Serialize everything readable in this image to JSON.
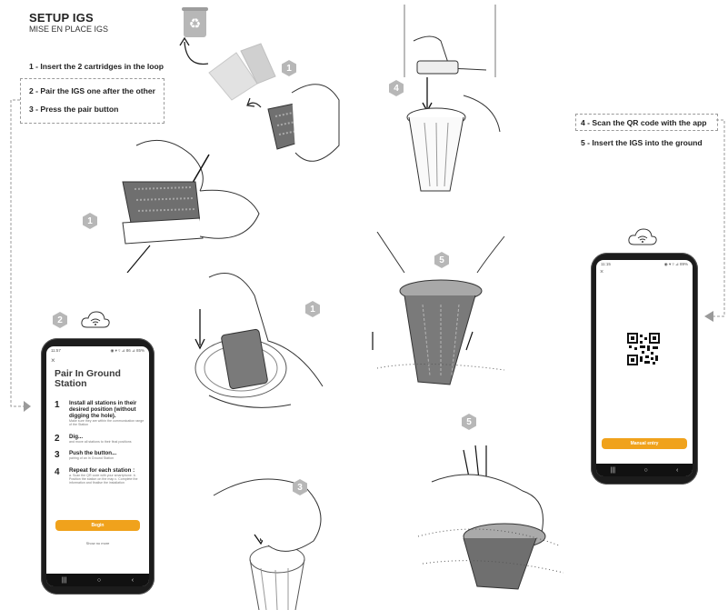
{
  "header": {
    "title": "SETUP IGS",
    "subtitle": "MISE EN PLACE IGS"
  },
  "steps_left": [
    "1 - Insert the 2 cartridges in the loop",
    "2 - Pair the IGS one after the other",
    "3 - Press the pair button"
  ],
  "steps_right": [
    "4 - Scan the QR code with the app",
    "5 - Insert the IGS into the ground"
  ],
  "badges": {
    "b1a": "1",
    "b1b": "1",
    "b1c": "1",
    "b2": "2",
    "b3": "3",
    "b4": "4",
    "b5a": "5",
    "b5b": "5"
  },
  "phone_left": {
    "status_time": "11:57",
    "status_right": "◉ ▾ ▿ ⊿ 86 ⊿ 85%",
    "close": "×",
    "title": "Pair In Ground Station",
    "steps": [
      {
        "num": "1",
        "title": "Install all stations in their desired position (without digging the hole).",
        "desc": "Make sure they are within the communication range of the Station"
      },
      {
        "num": "2",
        "title": "Dig...",
        "desc": "and move all stations to their final positions"
      },
      {
        "num": "3",
        "title": "Push the button...",
        "desc": "pairing of an In Ground Station"
      },
      {
        "num": "4",
        "title": "Repeat for each station :",
        "desc": "a. Scan the QR code with your smartphone. b. Position the station on the map c. Complete the information and finalise the installation"
      }
    ],
    "begin_button": "Begin",
    "link": "Show no more",
    "nav": [
      "|||",
      "○",
      "‹"
    ]
  },
  "phone_right": {
    "status_time": "11:15",
    "status_right": "◉ ▾ ▿ ⊿ 89%",
    "close": "×",
    "button": "Manual entry",
    "nav": [
      "|||",
      "○",
      "‹"
    ]
  },
  "colors": {
    "accent": "#f0a21c",
    "badge": "#b7b7b7",
    "dash": "#9a9a9a",
    "phone": "#1c1c1c"
  },
  "icons": [
    "recycle-bin-icon",
    "wifi-cloud-icon",
    "arrow-icon",
    "close-icon",
    "qr-code-icon"
  ]
}
